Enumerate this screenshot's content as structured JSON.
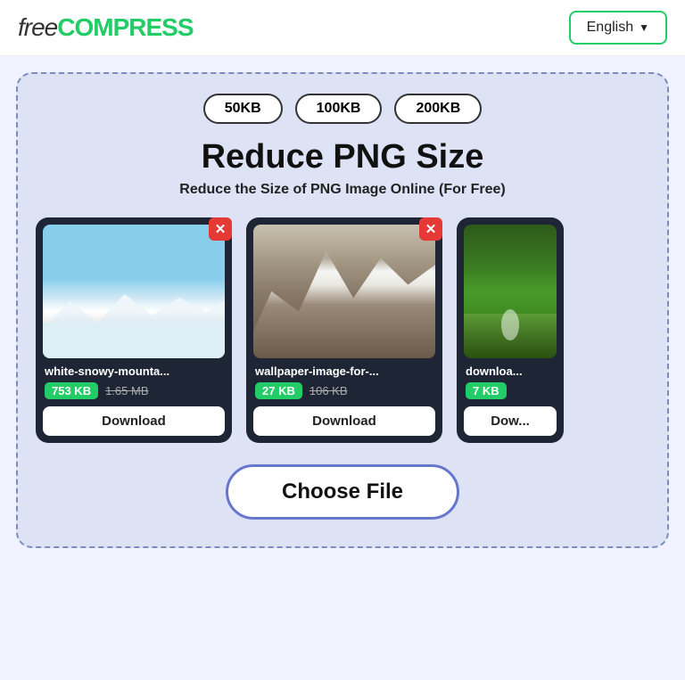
{
  "header": {
    "logo_free": "free",
    "logo_compress": "COMPRESS",
    "lang_label": "English",
    "lang_chevron": "▼"
  },
  "tool": {
    "size_options": [
      "50KB",
      "100KB",
      "200KB"
    ],
    "title": "Reduce PNG Size",
    "subtitle": "Reduce the Size of PNG Image Online (For Free)",
    "cards": [
      {
        "filename": "white-snowy-mounta...",
        "compressed_size": "753 KB",
        "original_size": "1.65 MB",
        "download_label": "Download",
        "type": "snowy"
      },
      {
        "filename": "wallpaper-image-for-...",
        "compressed_size": "27 KB",
        "original_size": "106 KB",
        "download_label": "Download",
        "type": "mountains"
      },
      {
        "filename": "downloa...",
        "compressed_size": "7 KB",
        "original_size": "...",
        "download_label": "Dow...",
        "type": "forest"
      }
    ],
    "choose_file_label": "Choose File"
  }
}
